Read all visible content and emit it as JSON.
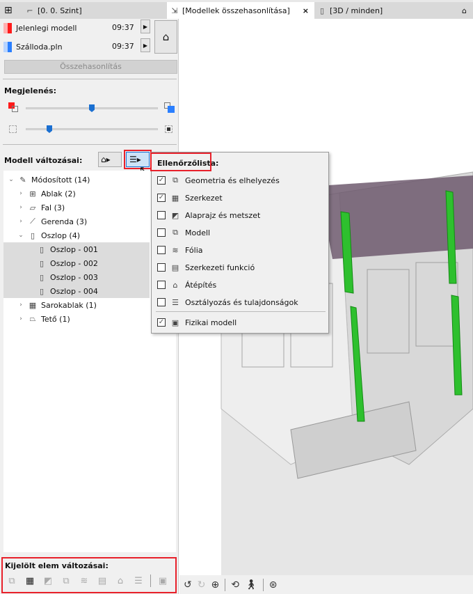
{
  "tabs": [
    {
      "label": "[0. 0. Szint]",
      "icon": "floor-plan-icon"
    },
    {
      "label": "[Modellek összehasonlítása]",
      "icon": "compare-icon",
      "active": true,
      "close": "×"
    },
    {
      "label": "[3D / minden]",
      "icon": "3d-icon"
    }
  ],
  "models": [
    {
      "name": "Jelenlegi modell",
      "time": "09:37",
      "color": "#ff1a1a",
      "light": "#ffb0b0"
    },
    {
      "name": "Szálloda.pln",
      "time": "09:37",
      "color": "#2a7fff",
      "light": "#b8d4ff"
    }
  ],
  "compare_button": "Összehasonlítás",
  "appearance": {
    "title": "Megjelenés:",
    "slider1": 0.5,
    "slider2": 0.2
  },
  "changes": {
    "title": "Modell változásai:"
  },
  "tree": [
    {
      "label": "Módosított (14)",
      "level": 0,
      "expanded": true,
      "icon": "pencil-icon"
    },
    {
      "label": "Ablak (2)",
      "level": 1,
      "icon": "window-icon"
    },
    {
      "label": "Fal (3)",
      "level": 1,
      "icon": "wall-icon"
    },
    {
      "label": "Gerenda (3)",
      "level": 1,
      "icon": "beam-icon"
    },
    {
      "label": "Oszlop (4)",
      "level": 1,
      "expanded": true,
      "icon": "column-icon"
    },
    {
      "label": "Oszlop - 001",
      "level": 2,
      "selected": true,
      "icon": "column-icon"
    },
    {
      "label": "Oszlop - 002",
      "level": 2,
      "selected": true,
      "icon": "column-icon"
    },
    {
      "label": "Oszlop - 003",
      "level": 2,
      "selected": true,
      "icon": "column-icon"
    },
    {
      "label": "Oszlop - 004",
      "level": 2,
      "selected": true,
      "icon": "column-icon"
    },
    {
      "label": "Sarokablak (1)",
      "level": 1,
      "icon": "corner-window-icon"
    },
    {
      "label": "Tető (1)",
      "level": 1,
      "icon": "roof-icon"
    }
  ],
  "checklist": {
    "title": "Ellenőrzőlista:",
    "items": [
      {
        "label": "Geometria és elhelyezés",
        "checked": true,
        "icon": "geometry-icon"
      },
      {
        "label": "Szerkezet",
        "checked": true,
        "icon": "structure-icon"
      },
      {
        "label": "Alaprajz és metszet",
        "checked": false,
        "icon": "floorplan-section-icon"
      },
      {
        "label": "Modell",
        "checked": false,
        "icon": "model-icon"
      },
      {
        "label": "Fólia",
        "checked": false,
        "icon": "layer-icon"
      },
      {
        "label": "Szerkezeti funkció",
        "checked": false,
        "icon": "structural-function-icon"
      },
      {
        "label": "Átépítés",
        "checked": false,
        "icon": "renovation-icon"
      },
      {
        "label": "Osztályozás és tulajdonságok",
        "checked": false,
        "icon": "classification-icon"
      }
    ],
    "footer": {
      "label": "Fizikai modell",
      "checked": true,
      "icon": "physical-model-icon"
    }
  },
  "selected_changes": {
    "title": "Kijelölt elem változásai:"
  },
  "colors": {
    "highlight": "#e8202a",
    "accent": "#1a6fd1",
    "column": "#22b322",
    "wall": "#6e5a6e"
  }
}
